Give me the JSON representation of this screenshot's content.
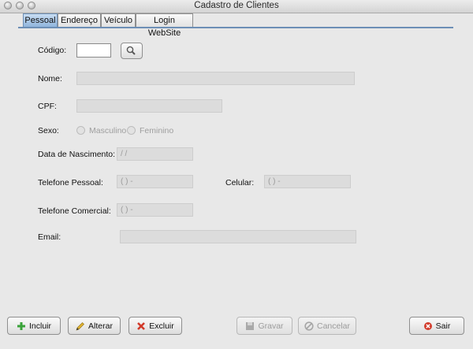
{
  "window": {
    "title": "Cadastro de Clientes"
  },
  "tabs": [
    {
      "label": "Pessoal",
      "active": true
    },
    {
      "label": "Endereço",
      "active": false
    },
    {
      "label": "Veículo",
      "active": false
    },
    {
      "label": "Login WebSite",
      "active": false
    }
  ],
  "form": {
    "codigo": {
      "label": "Código:",
      "value": ""
    },
    "nome": {
      "label": "Nome:",
      "value": ""
    },
    "cpf": {
      "label": "CPF:",
      "value": ""
    },
    "sexo": {
      "label": "Sexo:",
      "options": [
        "Masculino",
        "Feminino"
      ],
      "selected": null
    },
    "data_nascimento": {
      "label": "Data de Nascimento:",
      "value": " /  /"
    },
    "telefone_pessoal": {
      "label": "Telefone Pessoal:",
      "value": "(  )     -"
    },
    "celular": {
      "label": "Celular:",
      "value": "(  )     -"
    },
    "telefone_comercial": {
      "label": "Telefone Comercial:",
      "value": "(  )     -"
    },
    "email": {
      "label": "Email:",
      "value": ""
    }
  },
  "buttons": {
    "incluir": "Incluir",
    "alterar": "Alterar",
    "excluir": "Excluir",
    "gravar": "Gravar",
    "cancelar": "Cancelar",
    "sair": "Sair"
  },
  "icons": {
    "search": "magnifier-icon",
    "incluir": "plus-icon",
    "alterar": "pencil-icon",
    "excluir": "x-icon",
    "gravar": "floppy-icon",
    "cancelar": "cancel-icon",
    "sair": "exit-icon"
  },
  "colors": {
    "active_tab": "#90b5dc",
    "plus_green": "#3aa33a",
    "delete_red": "#d23a2a",
    "pencil_yellow": "#e2b431"
  }
}
